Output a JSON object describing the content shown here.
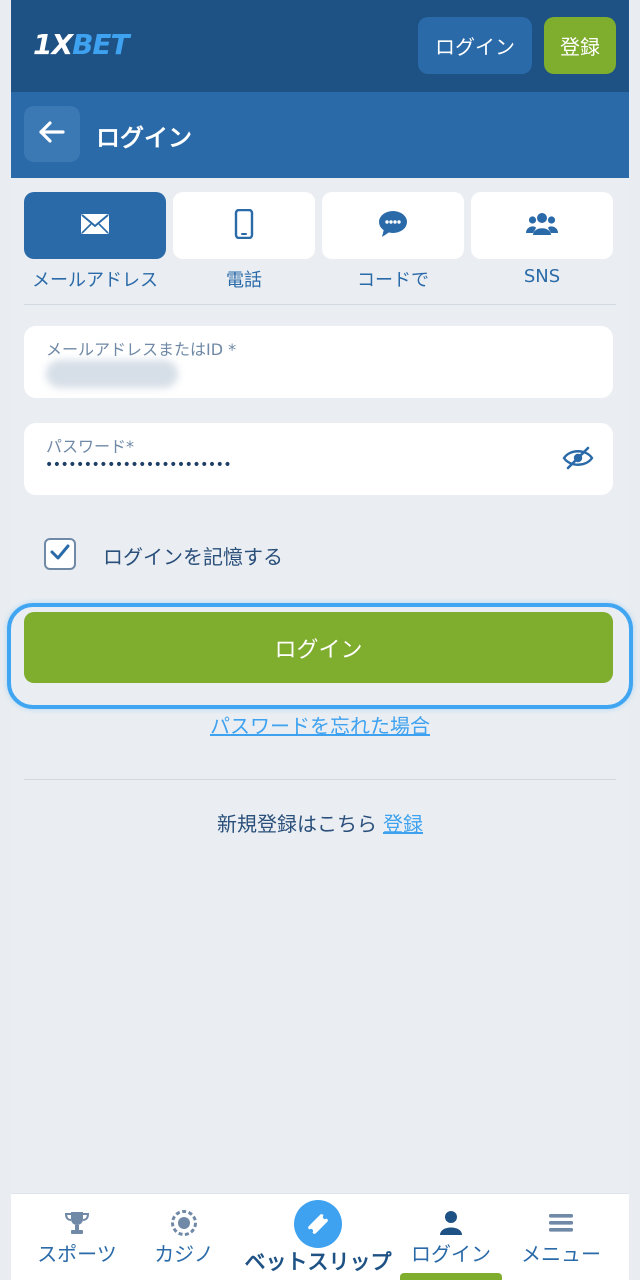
{
  "header": {
    "logo_prefix": "1X",
    "logo_suffix": "BET",
    "login_label": "ログイン",
    "register_label": "登録"
  },
  "subheader": {
    "back_icon": "arrow-left-icon",
    "title": "ログイン"
  },
  "login_methods": [
    {
      "label": "メールアドレス",
      "icon": "envelope-icon",
      "active": true
    },
    {
      "label": "電話",
      "icon": "phone-icon",
      "active": false
    },
    {
      "label": "コードで",
      "icon": "chat-bubble-icon",
      "active": false
    },
    {
      "label": "SNS",
      "icon": "users-icon",
      "active": false
    }
  ],
  "form": {
    "email_label": "メールアドレスまたはID *",
    "password_label": "パスワード*",
    "password_value": "••••••••••••••••••••••••",
    "remember_label": "ログインを記憶する",
    "remember_checked": true,
    "submit_label": "ログイン",
    "forgot_label": "パスワードを忘れた場合",
    "register_prompt": "新規登録はこちら",
    "register_link": "登録"
  },
  "bottom_nav": [
    {
      "label": "スポーツ",
      "icon": "trophy-icon"
    },
    {
      "label": "カジノ",
      "icon": "casino-chip-icon"
    },
    {
      "label": "ベットスリップ",
      "icon": "ticket-icon"
    },
    {
      "label": "ログイン",
      "icon": "user-icon",
      "active": true
    },
    {
      "label": "メニュー",
      "icon": "hamburger-menu-icon"
    }
  ],
  "colors": {
    "header_bg": "#1e5184",
    "subheader_bg": "#2a6aa8",
    "accent_green": "#7fad2e",
    "link_blue": "#3ea2f0",
    "page_bg": "#eaeef2"
  }
}
